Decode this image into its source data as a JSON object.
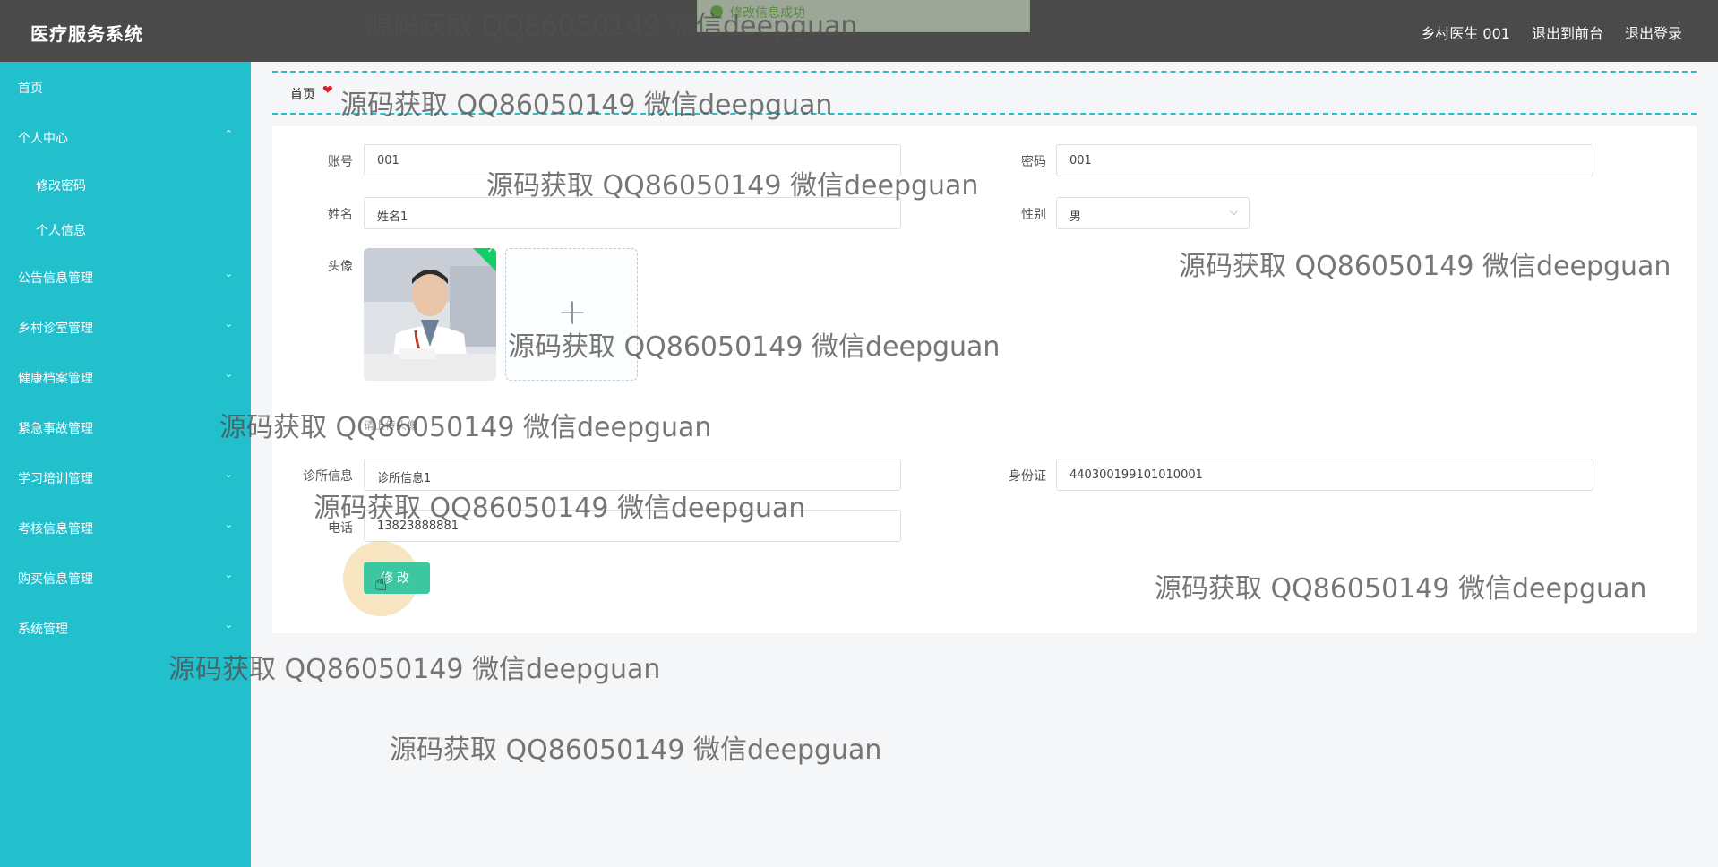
{
  "app": {
    "title": "医疗服务系统"
  },
  "toast": {
    "text": "修改信息成功"
  },
  "header": {
    "user_label": "乡村医生 001",
    "front_link": "退出到前台",
    "logout_link": "退出登录"
  },
  "sidebar": {
    "items": [
      {
        "label": "首页",
        "chevron": ""
      },
      {
        "label": "个人中心",
        "chevron": "⌃"
      },
      {
        "label": "修改密码",
        "chevron": ""
      },
      {
        "label": "个人信息",
        "chevron": ""
      },
      {
        "label": "公告信息管理",
        "chevron": "⌄"
      },
      {
        "label": "乡村诊室管理",
        "chevron": "⌄"
      },
      {
        "label": "健康档案管理",
        "chevron": "⌄"
      },
      {
        "label": "紧急事故管理",
        "chevron": ""
      },
      {
        "label": "学习培训管理",
        "chevron": "⌄"
      },
      {
        "label": "考核信息管理",
        "chevron": "⌄"
      },
      {
        "label": "购买信息管理",
        "chevron": "⌄"
      },
      {
        "label": "系统管理",
        "chevron": "⌄"
      }
    ]
  },
  "breadcrumb": {
    "home": "首页",
    "heart": "❤"
  },
  "form": {
    "account": {
      "label": "账号",
      "value": "001"
    },
    "password": {
      "label": "密码",
      "value": "001"
    },
    "name": {
      "label": "姓名",
      "value": "姓名1"
    },
    "gender": {
      "label": "性别",
      "value": "男"
    },
    "avatar": {
      "label": "头像",
      "plus": "+",
      "tip": "请上传头像"
    },
    "clinic": {
      "label": "诊所信息",
      "value": "诊所信息1"
    },
    "idcard": {
      "label": "身份证",
      "value": "440300199101010001"
    },
    "phone": {
      "label": "电话",
      "value": "13823888881"
    },
    "submit": "修改"
  },
  "watermark": "源码获取 QQ86050149 微信deepguan"
}
